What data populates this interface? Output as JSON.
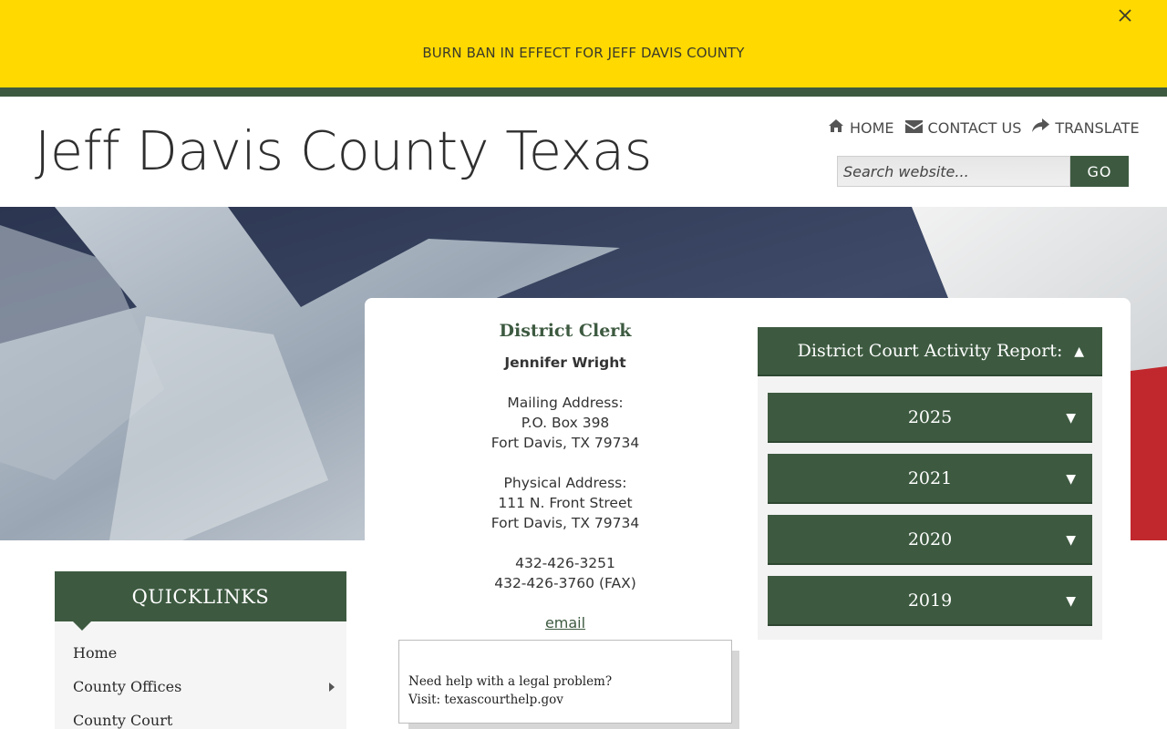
{
  "alert": {
    "text": "BURN BAN IN EFFECT FOR JEFF DAVIS COUNTY",
    "close_icon": "close-icon"
  },
  "header": {
    "site_title": "Jeff Davis County Texas",
    "nav": [
      {
        "label": "HOME",
        "icon": "home-icon"
      },
      {
        "label": "CONTACT US",
        "icon": "envelope-icon"
      },
      {
        "label": "TRANSLATE",
        "icon": "share-arrow-icon"
      }
    ],
    "search": {
      "placeholder": "Search website...",
      "value": "",
      "go_label": "GO"
    }
  },
  "clerk": {
    "title": "District Clerk",
    "name": "Jennifer Wright",
    "mailing": [
      "Mailing Address:",
      "P.O. Box 398",
      "Fort Davis, TX 79734"
    ],
    "physical": [
      "Physical Address:",
      "111 N. Front Street",
      "Fort Davis, TX 79734"
    ],
    "phones": [
      "432-426-3251",
      "432-426-3760 (FAX)"
    ],
    "email_label": "email"
  },
  "help": {
    "line1": "Need help with a legal problem?",
    "line2": "Visit:  texascourthelp.gov"
  },
  "accordion": {
    "header": "District Court Activity Report:",
    "header_arrow": "▲",
    "years": [
      {
        "label": "2025",
        "arrow": "▼"
      },
      {
        "label": "2021",
        "arrow": "▼"
      },
      {
        "label": "2020",
        "arrow": "▼"
      },
      {
        "label": "2019",
        "arrow": "▼"
      }
    ]
  },
  "quicklinks": {
    "header": "QUICKLINKS",
    "items": [
      {
        "label": "Home",
        "has_submenu": false
      },
      {
        "label": "County Offices",
        "has_submenu": true
      },
      {
        "label": "County Court",
        "has_submenu": false
      }
    ]
  },
  "colors": {
    "alert_bg": "#ffd900",
    "brand_green": "#3d5a40",
    "flag_blue": "#2f3a55",
    "flag_red": "#c0282d"
  }
}
